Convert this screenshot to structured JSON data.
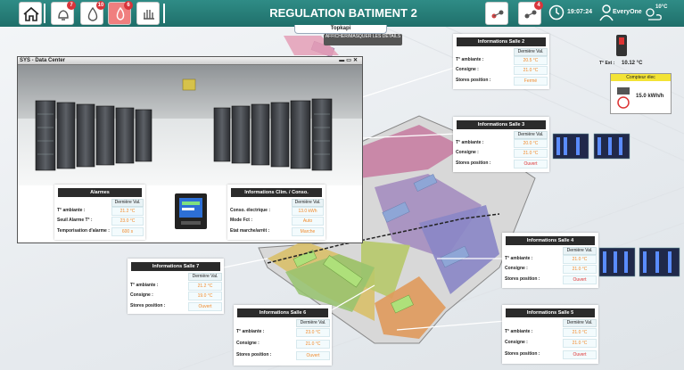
{
  "header": {
    "title": "REGULATION BATIMENT 2",
    "subtab": "Topkapi",
    "time": "19:07:24",
    "user": "EveryOne",
    "weather_temp": "10°C",
    "badges": {
      "alarms": "7",
      "water": "10",
      "fire": "6",
      "hand": "",
      "right1": "",
      "right2": "4"
    }
  },
  "detail_toggle": "AFFICHER/MASQUER LES DETAILS",
  "outdoor": {
    "label": "T° Ext :",
    "value": "10.12 °C"
  },
  "meter": {
    "title": "Compteur élec",
    "value": "15.0 kWh/h"
  },
  "window": {
    "title": "SYS - Data Center"
  },
  "col_header": "Dernière Val.",
  "alarms": {
    "title": "Alarmes",
    "rows": [
      {
        "label": "T° ambiante :",
        "value": "21.2 °C"
      },
      {
        "label": "Seuil Alarme T° :",
        "value": "23.0 °C"
      },
      {
        "label": "Temporisation d'alarme :",
        "value": "600 s"
      }
    ]
  },
  "clim": {
    "title": "Informations Clim. / Conso.",
    "rows": [
      {
        "label": "Conso. électrique :",
        "value": "13.0 kWh"
      },
      {
        "label": "Mode Fct :",
        "value": "Auto"
      },
      {
        "label": "Etat marche/arrêt :",
        "value": "Marche"
      }
    ]
  },
  "salles": {
    "s2": {
      "title": "Informations Salle 2",
      "rows": [
        {
          "label": "T° ambiante :",
          "value": "20.5 °C"
        },
        {
          "label": "Consigne :",
          "value": "21.0 °C"
        },
        {
          "label": "Stores position :",
          "value": "Fermé"
        }
      ]
    },
    "s3": {
      "title": "Informations Salle 3",
      "rows": [
        {
          "label": "T° ambiante :",
          "value": "20.0 °C"
        },
        {
          "label": "Consigne :",
          "value": "21.0 °C"
        },
        {
          "label": "Stores position :",
          "value": "Ouvert"
        }
      ]
    },
    "s4": {
      "title": "Informations Salle 4",
      "rows": [
        {
          "label": "T° ambiante :",
          "value": "21.0 °C"
        },
        {
          "label": "Consigne :",
          "value": "21.0 °C"
        },
        {
          "label": "Stores position :",
          "value": "Ouvert"
        }
      ]
    },
    "s5": {
      "title": "Informations Salle 5",
      "rows": [
        {
          "label": "T° ambiante :",
          "value": "21.0 °C"
        },
        {
          "label": "Consigne :",
          "value": "21.0 °C"
        },
        {
          "label": "Stores position :",
          "value": "Ouvert"
        }
      ]
    },
    "s6": {
      "title": "Informations Salle 6",
      "rows": [
        {
          "label": "T° ambiante :",
          "value": "23.0 °C"
        },
        {
          "label": "Consigne :",
          "value": "21.0 °C"
        },
        {
          "label": "Stores position :",
          "value": "Ouvert"
        }
      ]
    },
    "s7": {
      "title": "Informations Salle 7",
      "rows": [
        {
          "label": "T° ambiante :",
          "value": "21.2 °C"
        },
        {
          "label": "Consigne :",
          "value": "19.0 °C"
        },
        {
          "label": "Stores position :",
          "value": "Ouvert"
        }
      ]
    }
  }
}
